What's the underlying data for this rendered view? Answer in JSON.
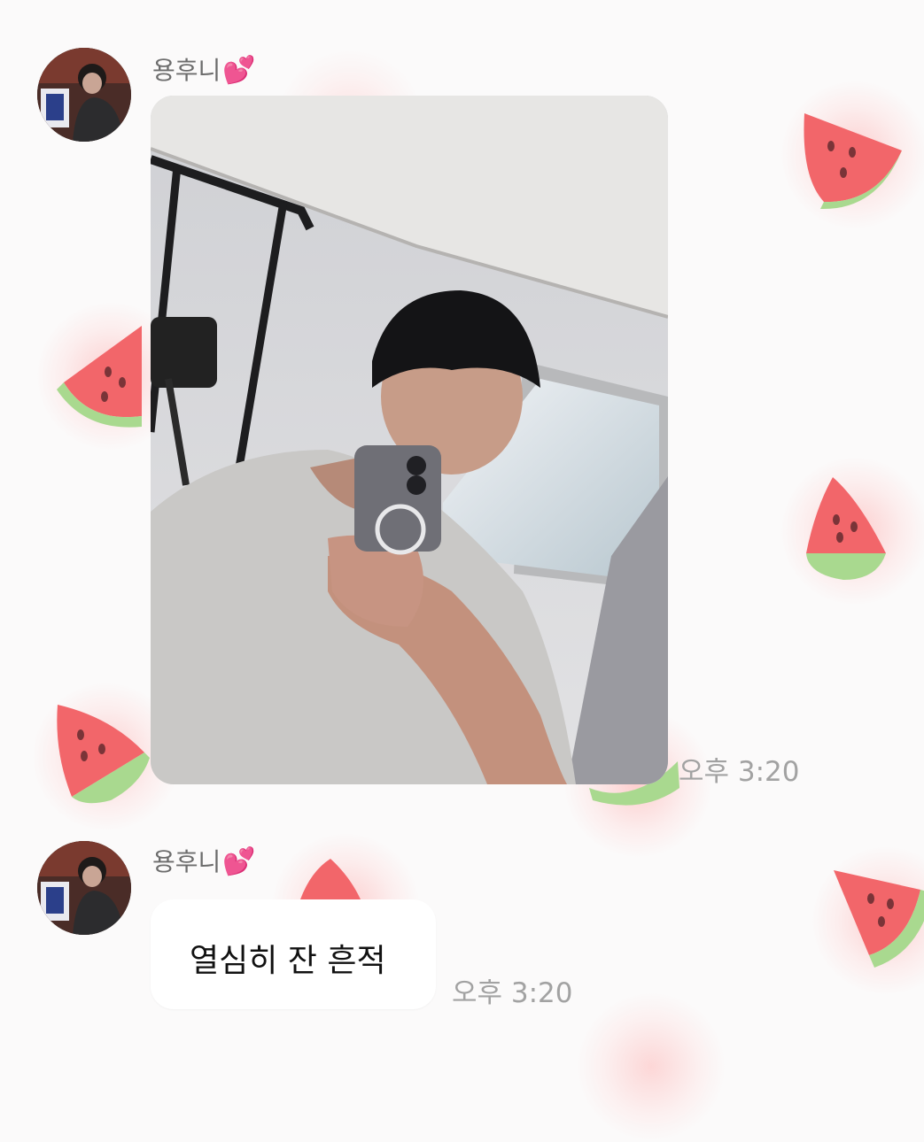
{
  "messages": [
    {
      "sender": "용후니",
      "sender_emoji": "💕",
      "type": "photo",
      "time": "오후 3:20"
    },
    {
      "sender": "용후니",
      "sender_emoji": "💕",
      "type": "text",
      "text": "열심히 잔 흔적",
      "time": "오후 3:20"
    }
  ],
  "colors": {
    "background": "#fbfafa",
    "watermelon_flesh": "#f2666a",
    "watermelon_rind": "#a9d98f",
    "seed": "#7a3438",
    "heart": "#e8468b",
    "timestamp": "#a2a2a2"
  },
  "icons": [
    "watermelon-icon",
    "sparkling-heart-icon",
    "avatar"
  ]
}
